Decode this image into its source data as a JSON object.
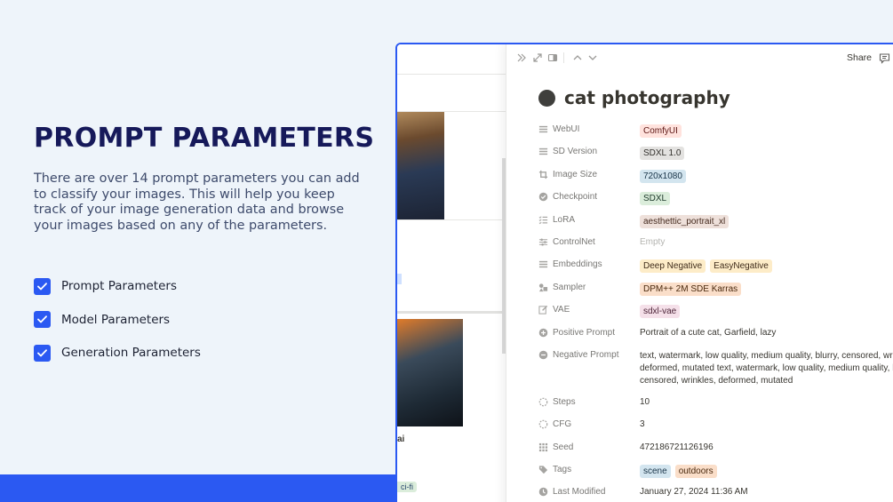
{
  "hero": {
    "heading": "PROMPT PARAMETERS",
    "description": "There are over 14 prompt parameters you can add to classify your images. This will help you keep track of your image generation data and browse your images based on any of the parameters.",
    "checklist": [
      {
        "label": "Prompt Parameters"
      },
      {
        "label": "Model Parameters"
      },
      {
        "label": "Generation Parameters"
      }
    ]
  },
  "gallery": {
    "caption": "ai",
    "tag": "ci-fi"
  },
  "topbar": {
    "share_label": "Share"
  },
  "page": {
    "title": "cat photography"
  },
  "properties": [
    {
      "key": "WebUI",
      "icon": "list-icon",
      "tags": [
        {
          "text": "ComfyUI",
          "bg": "#ffe2dd",
          "fg": "#5d1715"
        }
      ]
    },
    {
      "key": "SD Version",
      "icon": "list-icon",
      "tags": [
        {
          "text": "SDXL 1.0",
          "bg": "#e3e2e0",
          "fg": "#32302c"
        }
      ]
    },
    {
      "key": "Image Size",
      "icon": "crop-icon",
      "tags": [
        {
          "text": "720x1080",
          "bg": "#d3e5ef",
          "fg": "#183347"
        }
      ]
    },
    {
      "key": "Checkpoint",
      "icon": "check-circle-icon",
      "tags": [
        {
          "text": "SDXL",
          "bg": "#dbeddb",
          "fg": "#1c3829"
        }
      ]
    },
    {
      "key": "LoRA",
      "icon": "checklist-icon",
      "tags": [
        {
          "text": "aesthettic_portrait_xl",
          "bg": "#eee0da",
          "fg": "#442a1e"
        }
      ]
    },
    {
      "key": "ControlNet",
      "icon": "sliders-icon",
      "text": "Empty",
      "empty": true
    },
    {
      "key": "Embeddings",
      "icon": "list-icon",
      "tags": [
        {
          "text": "Deep Negative",
          "bg": "#fdecc8",
          "fg": "#402c1b"
        },
        {
          "text": "EasyNegative",
          "bg": "#fdecc8",
          "fg": "#402c1b"
        }
      ]
    },
    {
      "key": "Sampler",
      "icon": "shapes-icon",
      "tags": [
        {
          "text": "DPM++ 2M SDE Karras",
          "bg": "#fadec9",
          "fg": "#49290e"
        }
      ]
    },
    {
      "key": "VAE",
      "icon": "edit-icon",
      "tags": [
        {
          "text": "sdxl-vae",
          "bg": "#f5e0e9",
          "fg": "#4c2337"
        }
      ]
    },
    {
      "key": "Positive Prompt",
      "icon": "plus-circle-icon",
      "text": "Portrait of a cute cat, Garfield, lazy"
    },
    {
      "key": "Negative Prompt",
      "icon": "minus-circle-icon",
      "text": "text, watermark, low quality, medium quality, blurry, censored, wrinkles, deformed, mutated text, watermark, low quality, medium quality, blurry, censored, wrinkles, deformed, mutated",
      "wrap": true
    },
    {
      "key": "Steps",
      "icon": "dashed-circle-icon",
      "text": "10"
    },
    {
      "key": "CFG",
      "icon": "dashed-circle-icon",
      "text": "3"
    },
    {
      "key": "Seed",
      "icon": "grid-icon",
      "text": "472186721126196"
    },
    {
      "key": "Tags",
      "icon": "tag-icon",
      "tags": [
        {
          "text": "scene",
          "bg": "#d3e5ef",
          "fg": "#183347"
        },
        {
          "text": "outdoors",
          "bg": "#fadec9",
          "fg": "#49290e"
        }
      ]
    },
    {
      "key": "Last Modified",
      "icon": "clock-icon",
      "text": "January 27, 2024 11:36 AM"
    }
  ]
}
